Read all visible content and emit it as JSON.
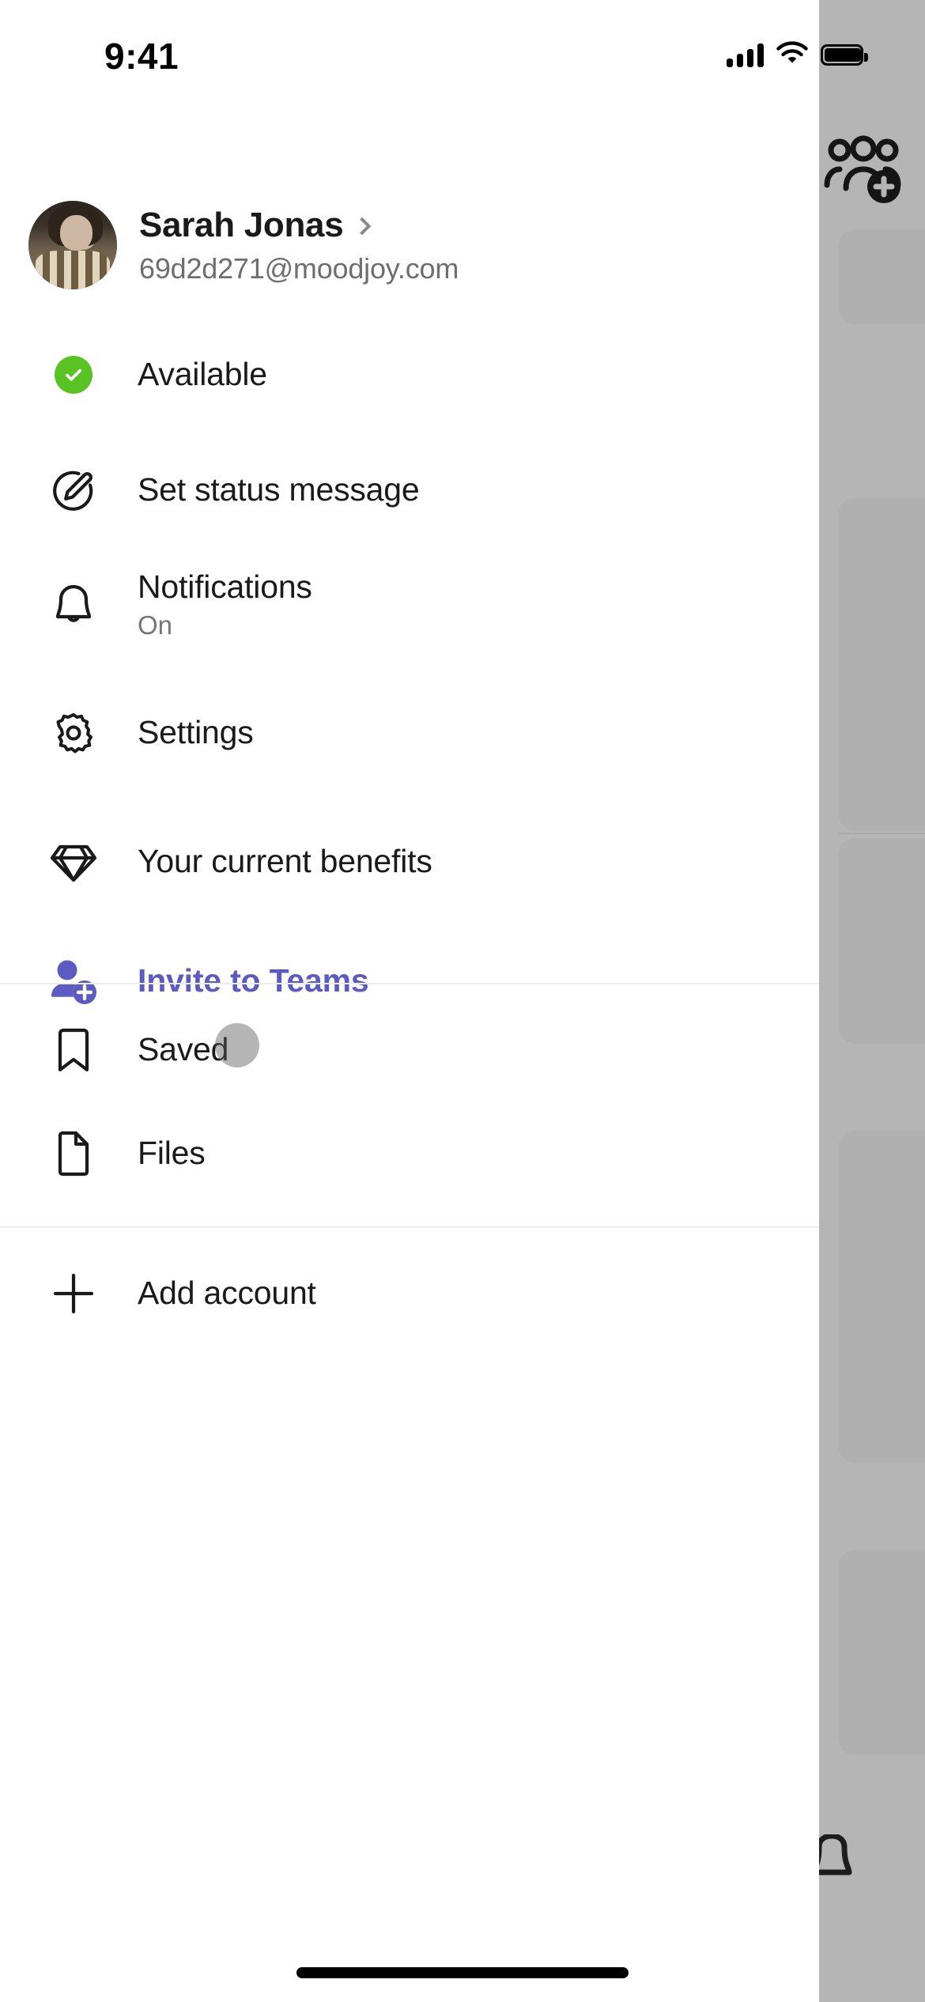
{
  "status_bar": {
    "time": "9:41",
    "signal_icon": "cellular-bars-icon",
    "wifi_icon": "wifi-icon",
    "battery_icon": "battery-full-icon"
  },
  "profile": {
    "name": "Sarah Jonas",
    "email": "69d2d271@moodjoy.com",
    "avatar_alt": "avatar",
    "chevron_icon": "chevron-right-icon"
  },
  "menu": {
    "sections": [
      {
        "items": [
          {
            "label": "Available",
            "sub": "",
            "icon": "status-available-icon",
            "accent": false
          },
          {
            "label": "Set status message",
            "sub": "",
            "icon": "pencil-circle-icon",
            "accent": false
          },
          {
            "label": "Notifications",
            "sub": "On",
            "icon": "bell-icon",
            "accent": false
          },
          {
            "label": "Settings",
            "sub": "",
            "icon": "gear-icon",
            "accent": false
          },
          {
            "label": "Your current benefits",
            "sub": "",
            "icon": "diamond-icon",
            "accent": false
          },
          {
            "label": "Invite to Teams",
            "sub": "",
            "icon": "person-add-icon",
            "accent": true
          }
        ]
      },
      {
        "items": [
          {
            "label": "Saved",
            "sub": "",
            "icon": "bookmark-icon",
            "accent": false
          },
          {
            "label": "Files",
            "sub": "",
            "icon": "file-icon",
            "accent": false
          }
        ]
      },
      {
        "items": [
          {
            "label": "Add account",
            "sub": "",
            "icon": "plus-icon",
            "accent": false
          }
        ]
      }
    ]
  },
  "background_app": {
    "add_team_icon": "people-add-icon",
    "bell_icon": "bell-icon"
  },
  "colors": {
    "accent_purple": "#5b5bc2",
    "available_green": "#58c322",
    "panel_background": "#ffffff",
    "scrim": "#b5b5b5",
    "text_primary": "#1a1a1a",
    "text_secondary": "#6e6e6e",
    "divider": "#ededed"
  },
  "touch_indicator": {
    "name": "touch-point"
  },
  "home_indicator": {
    "name": "home-indicator"
  }
}
